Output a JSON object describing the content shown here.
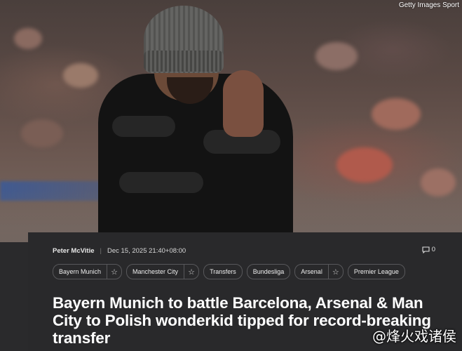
{
  "hero": {
    "image_credit": "Getty Images Sport"
  },
  "article": {
    "author": "Peter McVitie",
    "date": "Dec 15, 2025 21:40+08:00",
    "comment_count": "0",
    "tags": [
      {
        "label": "Bayern Munich",
        "followable": true
      },
      {
        "label": "Manchester City",
        "followable": true
      },
      {
        "label": "Transfers",
        "followable": false
      },
      {
        "label": "Bundesliga",
        "followable": false
      },
      {
        "label": "Arsenal",
        "followable": true
      },
      {
        "label": "Premier League",
        "followable": false
      }
    ],
    "headline": "Bayern Munich to battle Barcelona, Arsenal & Man City to Polish wonderkid tipped for record-breaking transfer"
  },
  "watermark": "@烽火戏诸侯",
  "icons": {
    "comment": "comment-bubble-icon",
    "follow": "star-icon"
  },
  "colors": {
    "background": "#1d1d1f",
    "panel": "#29292b",
    "text": "#ffffff",
    "tag_border": "#58585b"
  }
}
